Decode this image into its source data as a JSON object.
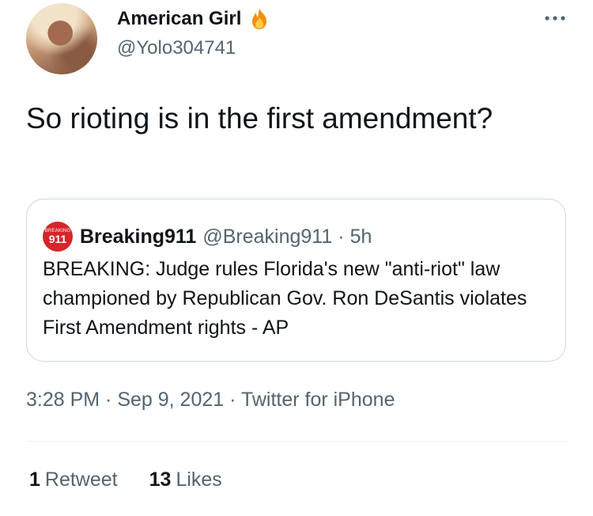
{
  "author": {
    "display_name": "American Girl",
    "handle": "@Yolo304741",
    "badge_icon": "fire-icon"
  },
  "tweet": {
    "text": "So rioting is in the first amendment?"
  },
  "quote": {
    "avatar_caption": "BREAKING",
    "avatar_text": "911",
    "name": "Breaking911",
    "handle": "@Breaking911",
    "separator": "·",
    "time": "5h",
    "text": "BREAKING: Judge rules Florida's new \"anti-riot\" law championed by Republican Gov. Ron DeSantis violates First Amendment rights - AP"
  },
  "meta": {
    "time": "3:28 PM",
    "separator": " · ",
    "date": "Sep 9, 2021",
    "source": "Twitter for iPhone"
  },
  "stats": {
    "retweets_count": "1",
    "retweets_label": "Retweet",
    "likes_count": "13",
    "likes_label": "Likes"
  },
  "colors": {
    "text": "#0f1419",
    "secondary": "#536471",
    "border": "#cfd9de",
    "quote_avatar": "#d6252b"
  }
}
